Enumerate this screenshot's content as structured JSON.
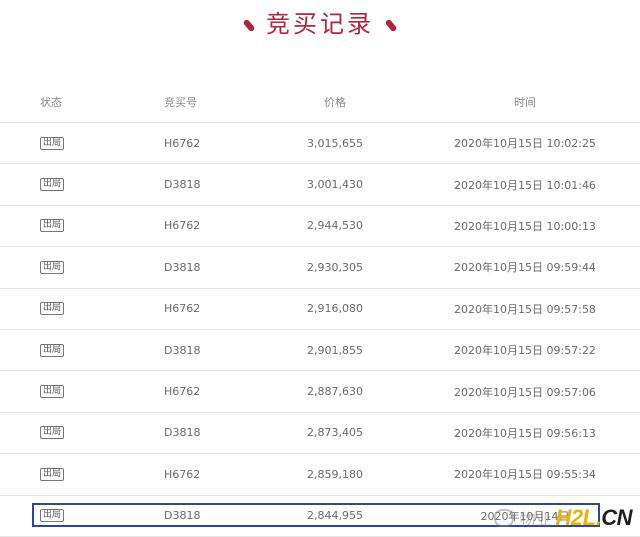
{
  "page": {
    "title": "竞买记录"
  },
  "table": {
    "headers": {
      "status": "状态",
      "bid_number": "竞买号",
      "price": "价格",
      "time": "时间"
    },
    "rows": [
      {
        "status": "出局",
        "bid_number": "H6762",
        "price": "3,015,655",
        "time": "2020年10月15日 10:02:25"
      },
      {
        "status": "出局",
        "bid_number": "D3818",
        "price": "3,001,430",
        "time": "2020年10月15日 10:01:46"
      },
      {
        "status": "出局",
        "bid_number": "H6762",
        "price": "2,944,530",
        "time": "2020年10月15日 10:00:13"
      },
      {
        "status": "出局",
        "bid_number": "D3818",
        "price": "2,930,305",
        "time": "2020年10月15日 09:59:44"
      },
      {
        "status": "出局",
        "bid_number": "H6762",
        "price": "2,916,080",
        "time": "2020年10月15日 09:57:58"
      },
      {
        "status": "出局",
        "bid_number": "D3818",
        "price": "2,901,855",
        "time": "2020年10月15日 09:57:22"
      },
      {
        "status": "出局",
        "bid_number": "H6762",
        "price": "2,887,630",
        "time": "2020年10月15日 09:57:06"
      },
      {
        "status": "出局",
        "bid_number": "D3818",
        "price": "2,873,405",
        "time": "2020年10月15日 09:56:13"
      },
      {
        "status": "出局",
        "bid_number": "H6762",
        "price": "2,859,180",
        "time": "2020年10月15日 09:55:34"
      },
      {
        "status": "出局",
        "bid_number": "D3818",
        "price": "2,844,955",
        "time": "2020年10月14日"
      }
    ]
  },
  "watermark": {
    "text": "物业",
    "logo_main": "H2L",
    "logo_dot": ".",
    "logo_tld": "CN"
  },
  "colors": {
    "accent": "#b3243f",
    "highlight_border": "#2b4a8c",
    "logo_yellow": "#e8b20f"
  },
  "icons": {
    "title_decoration": "tick-mark-icon",
    "watermark_glyph": "wechat-icon"
  }
}
